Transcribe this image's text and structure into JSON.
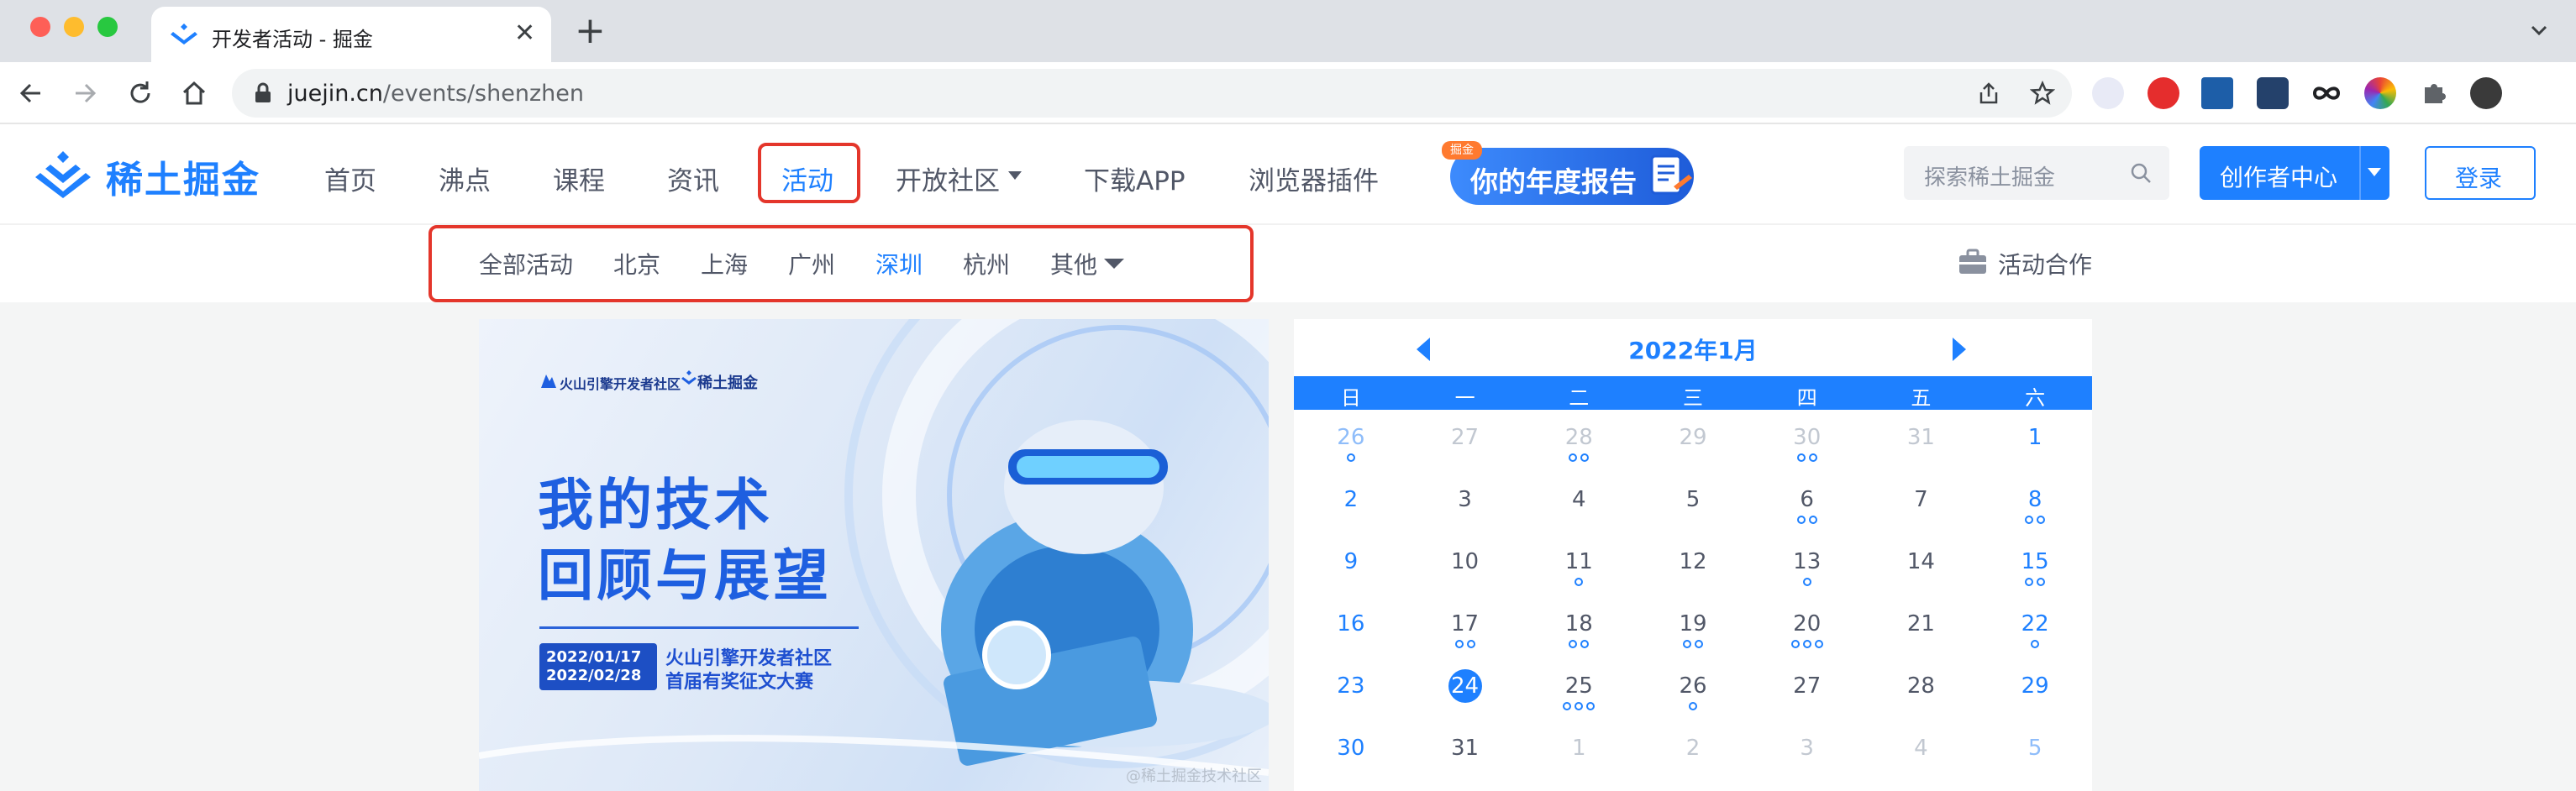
{
  "browser": {
    "tab_title": "开发者活动 - 掘金",
    "new_tab_label": "+",
    "close_label": "✕",
    "url_host": "juejin.cn",
    "url_path": "/events/shenzhen"
  },
  "header": {
    "logo_text": "稀土掘金",
    "nav": [
      "首页",
      "沸点",
      "课程",
      "资讯",
      "活动",
      "开放社区",
      "下载APP",
      "浏览器插件"
    ],
    "active_nav": "活动",
    "banner_text": "你的年度报告",
    "banner_tag": "掘金",
    "search_placeholder": "探索稀土掘金",
    "creator_label": "创作者中心",
    "login_label": "登录"
  },
  "subnav": {
    "cities": [
      "全部活动",
      "北京",
      "上海",
      "广州",
      "深圳",
      "杭州",
      "其他"
    ],
    "active_city": "深圳",
    "coop_label": "活动合作"
  },
  "hero": {
    "org": "火山引擎开发者社区",
    "brand": "稀土掘金",
    "title_lines": [
      "我的技术",
      "回顾与展望"
    ],
    "dates": [
      "2022/01/17",
      "2022/02/28"
    ],
    "sub_lines": [
      "火山引擎开发者社区",
      "首届有奖征文大赛"
    ],
    "watermark": "@稀土掘金技术社区"
  },
  "calendar": {
    "title": "2022年1月",
    "weekdays": [
      "日",
      "一",
      "二",
      "三",
      "四",
      "五",
      "六"
    ],
    "today": 24,
    "weeks": [
      [
        {
          "d": "26",
          "m": 0,
          "n": 1
        },
        {
          "d": "27",
          "m": 0,
          "n": 0
        },
        {
          "d": "28",
          "m": 0,
          "n": 2
        },
        {
          "d": "29",
          "m": 0,
          "n": 0
        },
        {
          "d": "30",
          "m": 0,
          "n": 2
        },
        {
          "d": "31",
          "m": 0,
          "n": 0
        },
        {
          "d": "1",
          "m": 1,
          "n": 0
        }
      ],
      [
        {
          "d": "2",
          "m": 1,
          "n": 0
        },
        {
          "d": "3",
          "m": 1,
          "n": 0
        },
        {
          "d": "4",
          "m": 1,
          "n": 0
        },
        {
          "d": "5",
          "m": 1,
          "n": 0
        },
        {
          "d": "6",
          "m": 1,
          "n": 2
        },
        {
          "d": "7",
          "m": 1,
          "n": 0
        },
        {
          "d": "8",
          "m": 1,
          "n": 2
        }
      ],
      [
        {
          "d": "9",
          "m": 1,
          "n": 0
        },
        {
          "d": "10",
          "m": 1,
          "n": 0
        },
        {
          "d": "11",
          "m": 1,
          "n": 1
        },
        {
          "d": "12",
          "m": 1,
          "n": 0
        },
        {
          "d": "13",
          "m": 1,
          "n": 1
        },
        {
          "d": "14",
          "m": 1,
          "n": 0
        },
        {
          "d": "15",
          "m": 1,
          "n": 2
        }
      ],
      [
        {
          "d": "16",
          "m": 1,
          "n": 0
        },
        {
          "d": "17",
          "m": 1,
          "n": 2
        },
        {
          "d": "18",
          "m": 1,
          "n": 2
        },
        {
          "d": "19",
          "m": 1,
          "n": 2
        },
        {
          "d": "20",
          "m": 1,
          "n": 3
        },
        {
          "d": "21",
          "m": 1,
          "n": 0
        },
        {
          "d": "22",
          "m": 1,
          "n": 1
        }
      ],
      [
        {
          "d": "23",
          "m": 1,
          "n": 0
        },
        {
          "d": "24",
          "m": 1,
          "n": 0
        },
        {
          "d": "25",
          "m": 1,
          "n": 3
        },
        {
          "d": "26",
          "m": 1,
          "n": 1
        },
        {
          "d": "27",
          "m": 1,
          "n": 0
        },
        {
          "d": "28",
          "m": 1,
          "n": 0
        },
        {
          "d": "29",
          "m": 1,
          "n": 0
        }
      ],
      [
        {
          "d": "30",
          "m": 1,
          "n": 0
        },
        {
          "d": "31",
          "m": 1,
          "n": 0
        },
        {
          "d": "1",
          "m": 0,
          "n": 0
        },
        {
          "d": "2",
          "m": 0,
          "n": 0
        },
        {
          "d": "3",
          "m": 0,
          "n": 0
        },
        {
          "d": "4",
          "m": 0,
          "n": 0
        },
        {
          "d": "5",
          "m": 0,
          "n": 0
        }
      ]
    ]
  },
  "colors": {
    "accent": "#1e80ff",
    "highlight_box": "#e4362b",
    "text": "#515767",
    "muted": "#8a919f"
  },
  "icons": [
    "back-arrow-icon",
    "forward-arrow-icon",
    "reload-icon",
    "home-icon",
    "lock-icon",
    "share-icon",
    "star-icon",
    "extension-icons",
    "avatar",
    "search-icon",
    "briefcase-icon"
  ]
}
